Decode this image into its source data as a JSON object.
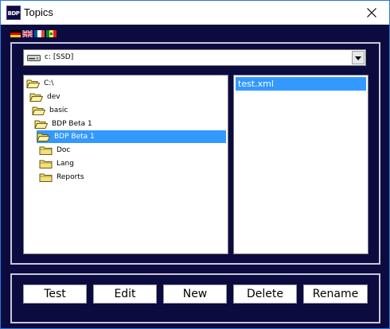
{
  "window": {
    "title": "Topics",
    "app_icon_text": "BDP",
    "accent_border": "#2b79d8",
    "background": "#0b0b40"
  },
  "language_flags": [
    "german-flag",
    "uk-flag",
    "french-flag",
    "senegal-flag"
  ],
  "drive_selector": {
    "value": "c: [SSD]",
    "icon": "hard-drive-icon"
  },
  "directory_tree": {
    "nodes": [
      {
        "label": "C:\\"
      },
      {
        "label": "dev"
      },
      {
        "label": "basic"
      },
      {
        "label": "BDP Beta 1"
      },
      {
        "label": "BDP Beta 1",
        "selected": true
      },
      {
        "label": "Doc"
      },
      {
        "label": "Lang"
      },
      {
        "label": "Reports"
      }
    ],
    "selection_color": "#3399ff"
  },
  "file_list": {
    "items": [
      {
        "label": "test.xml",
        "selected": true
      }
    ]
  },
  "buttons": {
    "test": "Test",
    "edit": "Edit",
    "new": "New",
    "delete": "Delete",
    "rename": "Rename"
  }
}
